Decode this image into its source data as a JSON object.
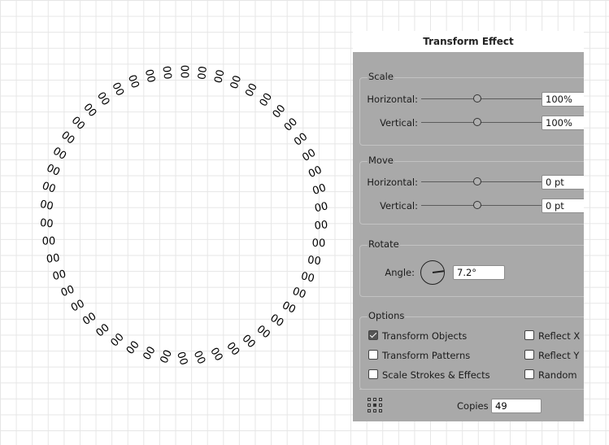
{
  "canvas": {
    "glyph_text": "00",
    "copies_drawn": 49,
    "rotation_step_deg": 7.2
  },
  "panel": {
    "title": "Transform Effect",
    "scale": {
      "title": "Scale",
      "horizontal_label": "Horizontal:",
      "horizontal_value": "100%",
      "vertical_label": "Vertical:",
      "vertical_value": "100%"
    },
    "move": {
      "title": "Move",
      "horizontal_label": "Horizontal:",
      "horizontal_value": "0 pt",
      "vertical_label": "Vertical:",
      "vertical_value": "0 pt"
    },
    "rotate": {
      "title": "Rotate",
      "angle_label": "Angle:",
      "angle_value": "7.2°"
    },
    "options": {
      "title": "Options",
      "transform_objects": {
        "label": "Transform Objects",
        "checked": true
      },
      "transform_patterns": {
        "label": "Transform Patterns",
        "checked": false
      },
      "scale_strokes": {
        "label": "Scale Strokes & Effects",
        "checked": false
      },
      "reflect_x": {
        "label": "Reflect X",
        "checked": false
      },
      "reflect_y": {
        "label": "Reflect Y",
        "checked": false
      },
      "random": {
        "label": "Random",
        "checked": false
      }
    },
    "copies_label": "Copies",
    "copies_value": "49",
    "reference_point_icon": "reference-point-grid-icon"
  }
}
